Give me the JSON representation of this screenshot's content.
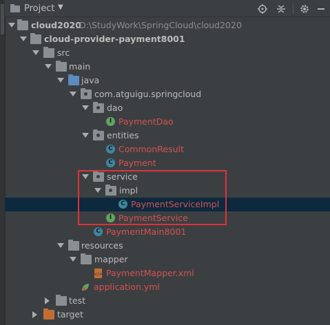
{
  "header": {
    "title": "Project",
    "buttons": [
      "target-icon",
      "collapse-icon",
      "gear-icon",
      "minimize-icon"
    ]
  },
  "tree": {
    "cloud2020": {
      "name": "cloud2020",
      "path": "D:\\StudyWork\\SpringCloud\\cloud2020"
    },
    "payment_module": "cloud-provider-payment8001",
    "src": "src",
    "main": "main",
    "java": "java",
    "package": "com.atguigu.springcloud",
    "dao": "dao",
    "payment_dao": "PaymentDao",
    "entities": "entities",
    "common_result": "CommonResult",
    "payment": "Payment",
    "service": "service",
    "impl": "impl",
    "payment_service_impl": "PaymentServiceImpl",
    "payment_service": "PaymentService",
    "payment_main": "PaymentMain8001",
    "resources": "resources",
    "mapper": "mapper",
    "payment_mapper_xml": "PaymentMapper.xml",
    "application_yml": "application.yml",
    "test": "test",
    "target": "target"
  },
  "colors": {
    "background": "#3c3f41",
    "selected_row": "#0d293e",
    "error_text": "#d25252",
    "highlight_box": "#e0323b"
  }
}
